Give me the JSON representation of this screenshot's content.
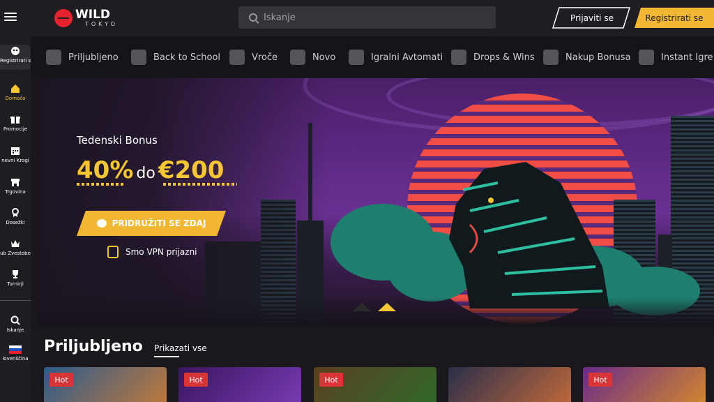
{
  "header": {
    "logo_top": "WILD",
    "logo_bottom": "TOKYO",
    "search_placeholder": "Iskanje",
    "login_label": "Prijaviti se",
    "register_label": "Registrirati se"
  },
  "sidebar": {
    "items": [
      {
        "label": "Registrirati se",
        "icon": "register-icon"
      },
      {
        "label": "Domačo",
        "icon": "home-icon"
      },
      {
        "label": "Promocije",
        "icon": "gift-icon"
      },
      {
        "label": "nevni Krogi",
        "icon": "calendar-icon"
      },
      {
        "label": "Trgovina",
        "icon": "shop-icon"
      },
      {
        "label": "Dosežki",
        "icon": "achievement-icon"
      },
      {
        "label": "ub Zvestobe",
        "icon": "crown-icon"
      },
      {
        "label": "Turnirji",
        "icon": "trophy-icon"
      },
      {
        "label": "Iskanje",
        "icon": "search-icon"
      },
      {
        "label": "lovenščina",
        "icon": "flag-si-icon"
      }
    ],
    "active_color": "#f5c534"
  },
  "categories": [
    {
      "label": "Priljubljeno",
      "icon": "favorites-icon"
    },
    {
      "label": "Back to School",
      "icon": "backpack-icon"
    },
    {
      "label": "Vroče",
      "icon": "fire-icon"
    },
    {
      "label": "Novo",
      "icon": "new-icon"
    },
    {
      "label": "Igralni Avtomati",
      "icon": "slot-icon"
    },
    {
      "label": "Drops & Wins",
      "icon": "drops-wins-icon"
    },
    {
      "label": "Nakup Bonusa",
      "icon": "bonus-buy-icon"
    },
    {
      "label": "Instant Igre",
      "icon": "instant-icon"
    }
  ],
  "hero": {
    "title": "Tedenski Bonus",
    "amount_pct": "40%",
    "amount_do": "do",
    "amount_eur": "€200",
    "cta": "PRIDRUŽITI SE ZDAJ",
    "vpn_text": "Smo VPN prijazni"
  },
  "section": {
    "title": "Priljubljeno",
    "show_all": "Prikazati vse"
  },
  "cards": [
    {
      "badge": "Hot"
    },
    {
      "badge": "Hot"
    },
    {
      "badge": "Hot"
    },
    {
      "badge": ""
    },
    {
      "badge": "Hot"
    }
  ],
  "colors": {
    "accent": "#f2b833",
    "hot": "#d93437",
    "bg": "#1a171d"
  }
}
